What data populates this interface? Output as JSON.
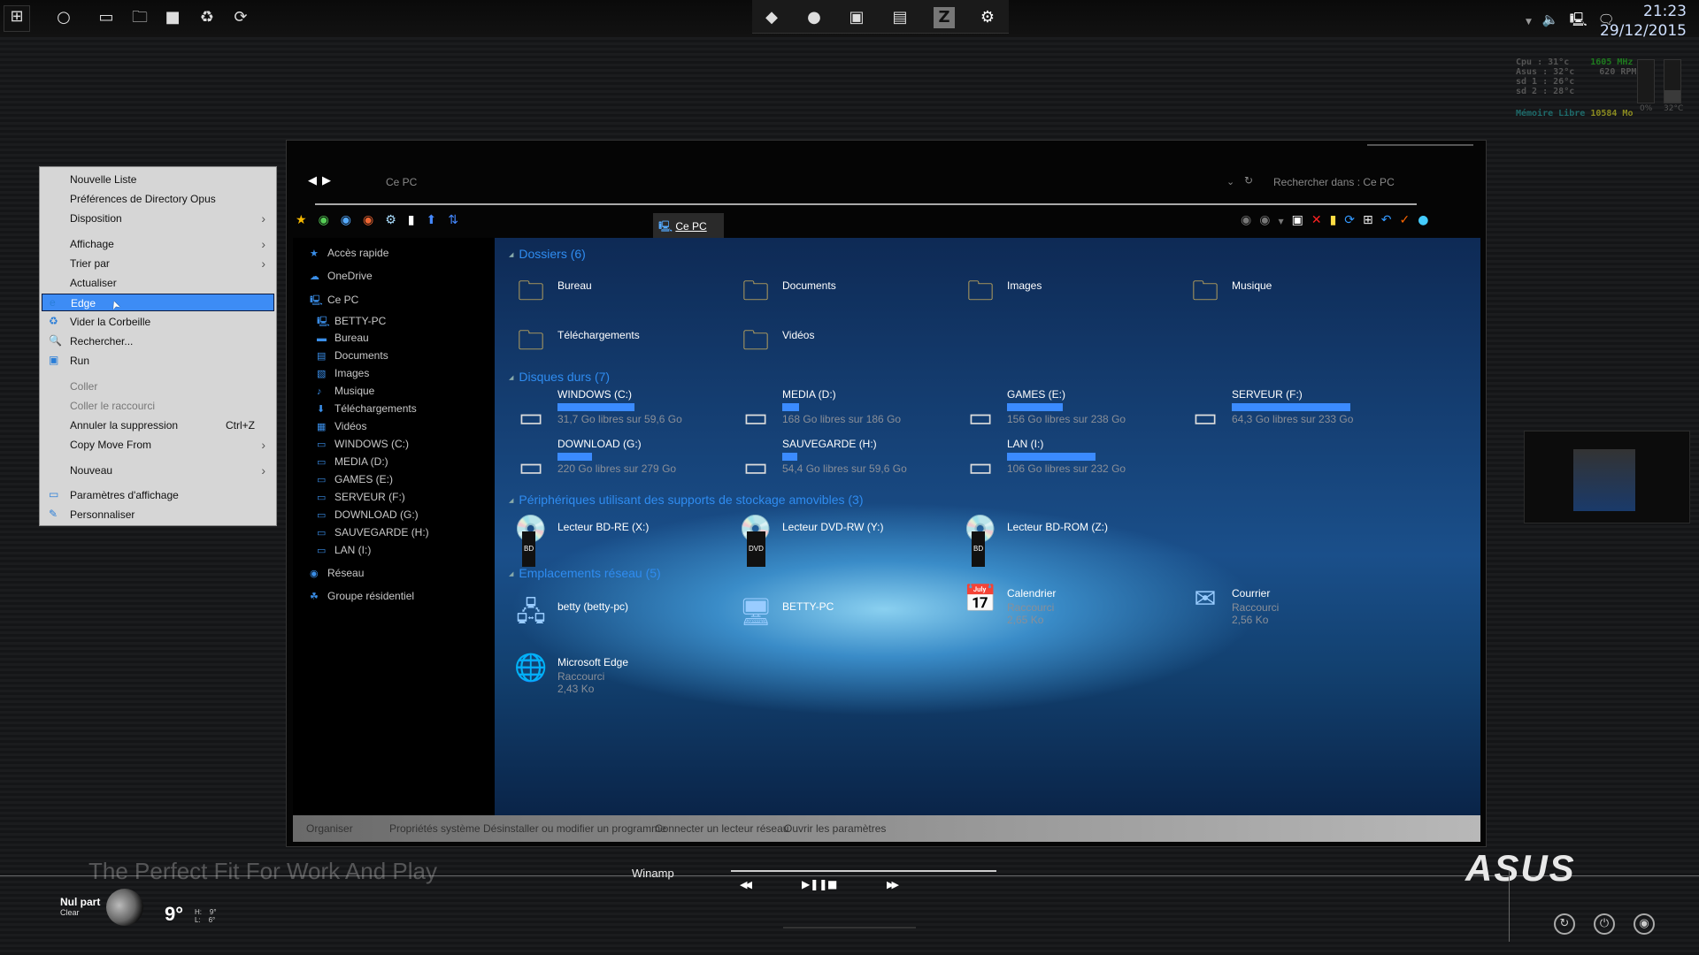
{
  "taskbar": {
    "left_icons": [
      "windows-start-icon",
      "cortana-circle-icon",
      "task-view-icon",
      "file-explorer-icon",
      "camera-icon",
      "recycle-icon",
      "steam-icon"
    ],
    "center_icons": [
      "dock-drive-icon",
      "dock-webcam-icon",
      "dock-media-icon",
      "dock-archive-icon",
      "dock-z-icon",
      "dock-settings-icon"
    ],
    "tray_icons": [
      "chevron-up-icon",
      "volume-icon",
      "network-icon",
      "notifications-icon"
    ],
    "time": "21:23",
    "date": "29/12/2015"
  },
  "sysmon": {
    "cpu_label": "Cpu :",
    "cpu": "31°c",
    "asus_label": "Asus :",
    "asus": "32°c",
    "sd1_label": "sd 1 :",
    "sd1": "26°c",
    "sd2_label": "sd 2 :",
    "sd2": "28°c",
    "freq": "1605 MHz",
    "rpm": "620 RPM",
    "mem_label": "Mémoire Libre",
    "mem": "10584 Mo",
    "meter1": "0%",
    "meter2": "32°C",
    "meter2_level": 0.3,
    "colors": {
      "freq": "#1f7a1f",
      "mem_label": "#1e6a6a",
      "mem": "#8a8a20"
    }
  },
  "context_menu": {
    "items": [
      {
        "label": "Nouvelle Liste"
      },
      {
        "label": "Préférences de Directory Opus"
      },
      {
        "label": "Disposition",
        "submenu": true
      },
      {
        "label": "Affichage",
        "submenu": true
      },
      {
        "label": "Trier par",
        "submenu": true
      },
      {
        "label": "Actualiser"
      },
      {
        "label": "Edge",
        "icon": "edge-icon",
        "selected": true
      },
      {
        "label": "Vider la Corbeille",
        "icon": "recycle-bin-icon"
      },
      {
        "label": "Rechercher...",
        "icon": "search-icon"
      },
      {
        "label": "Run",
        "icon": "run-icon"
      },
      {
        "label": "Coller",
        "disabled": true
      },
      {
        "label": "Coller le raccourci",
        "disabled": true
      },
      {
        "label": "Annuler la suppression",
        "shortcut": "Ctrl+Z"
      },
      {
        "label": "Copy Move From",
        "submenu": true
      },
      {
        "label": "Nouveau",
        "submenu": true
      },
      {
        "label": "Paramètres d'affichage",
        "icon": "display-icon"
      },
      {
        "label": "Personnaliser",
        "icon": "personalize-icon"
      }
    ]
  },
  "explorer": {
    "address": "Ce PC",
    "search_placeholder": "Rechercher dans : Ce PC",
    "tab": "Ce PC",
    "tab_close": "x",
    "sidebar": [
      {
        "label": "Accès rapide",
        "icon": "star-icon",
        "level": 0
      },
      {
        "label": "OneDrive",
        "icon": "cloud-icon",
        "level": 0
      },
      {
        "label": "Ce PC",
        "icon": "computer-icon",
        "level": 0
      },
      {
        "label": "BETTY-PC",
        "icon": "computer-icon",
        "level": 1
      },
      {
        "label": "Bureau",
        "icon": "desktop-icon",
        "level": 1
      },
      {
        "label": "Documents",
        "icon": "document-icon",
        "level": 1
      },
      {
        "label": "Images",
        "icon": "image-icon",
        "level": 1
      },
      {
        "label": "Musique",
        "icon": "music-icon",
        "level": 1
      },
      {
        "label": "Téléchargements",
        "icon": "download-icon",
        "level": 1
      },
      {
        "label": "Vidéos",
        "icon": "video-icon",
        "level": 1
      },
      {
        "label": "WINDOWS (C:)",
        "icon": "drive-icon",
        "level": 1
      },
      {
        "label": "MEDIA (D:)",
        "icon": "drive-icon",
        "level": 1
      },
      {
        "label": "GAMES (E:)",
        "icon": "drive-icon",
        "level": 1
      },
      {
        "label": "SERVEUR (F:)",
        "icon": "drive-icon",
        "level": 1
      },
      {
        "label": "DOWNLOAD (G:)",
        "icon": "drive-icon",
        "level": 1
      },
      {
        "label": "SAUVEGARDE (H:)",
        "icon": "drive-icon",
        "level": 1
      },
      {
        "label": "LAN (I:)",
        "icon": "drive-icon",
        "level": 1
      },
      {
        "label": "Réseau",
        "icon": "network-icon",
        "level": 0
      },
      {
        "label": "Groupe résidentiel",
        "icon": "homegroup-icon",
        "level": 0
      }
    ],
    "groups": {
      "folders": "Dossiers (6)",
      "drives": "Disques durs (7)",
      "removable": "Périphériques utilisant des supports de stockage amovibles (3)",
      "network": "Emplacements réseau (5)"
    },
    "folders": [
      {
        "label": "Bureau",
        "icon": "folder-desktop-icon"
      },
      {
        "label": "Documents",
        "icon": "folder-documents-icon"
      },
      {
        "label": "Images",
        "icon": "folder-images-icon"
      },
      {
        "label": "Musique",
        "icon": "folder-music-icon"
      },
      {
        "label": "Téléchargements",
        "icon": "folder-downloads-icon"
      },
      {
        "label": "Vidéos",
        "icon": "folder-videos-icon"
      }
    ],
    "drives": [
      {
        "label": "WINDOWS (C:)",
        "free": "31,7 Go libres sur 59,6 Go",
        "used": 0.47
      },
      {
        "label": "MEDIA (D:)",
        "free": "168 Go libres sur 186 Go",
        "used": 0.1
      },
      {
        "label": "GAMES (E:)",
        "free": "156 Go libres sur 238 Go",
        "used": 0.34
      },
      {
        "label": "SERVEUR (F:)",
        "free": "64,3 Go libres sur 233 Go",
        "used": 0.72
      },
      {
        "label": "DOWNLOAD (G:)",
        "free": "220 Go libres sur 279 Go",
        "used": 0.21
      },
      {
        "label": "SAUVEGARDE (H:)",
        "free": "54,4 Go libres sur 59,6 Go",
        "used": 0.09
      },
      {
        "label": "LAN (I:)",
        "free": "106 Go libres sur 232 Go",
        "used": 0.54
      }
    ],
    "removable": [
      {
        "label": "Lecteur BD-RE (X:)",
        "badge": "BD"
      },
      {
        "label": "Lecteur DVD-RW (Y:)",
        "badge": "DVD"
      },
      {
        "label": "Lecteur BD-ROM (Z:)",
        "badge": "BD"
      }
    ],
    "network": [
      {
        "label": "betty (betty-pc)",
        "icon": "network-share-icon"
      },
      {
        "label": "BETTY-PC",
        "icon": "computer-icon"
      },
      {
        "label": "Calendrier",
        "sub1": "Raccourci",
        "sub2": "2,65 Ko",
        "icon": "calendar-icon"
      },
      {
        "label": "Courrier",
        "sub1": "Raccourci",
        "sub2": "2,56 Ko",
        "icon": "mail-icon"
      },
      {
        "label": "Microsoft Edge",
        "sub1": "Raccourci",
        "sub2": "2,43 Ko",
        "icon": "globe-icon"
      }
    ],
    "bottom_bar": [
      "Organiser",
      "Propriétés système",
      "Désinstaller ou modifier un programme",
      "Connecter un lecteur réseau",
      "Ouvrir les paramètres"
    ]
  },
  "desktop": {
    "tagline": "The Perfect Fit For Work And Play",
    "brand": "ASUS",
    "weather": {
      "location": "Nul part",
      "condition": "Clear",
      "temp": "9°",
      "high_label": "H:",
      "high": "9°",
      "low_label": "L:",
      "low": "6°"
    },
    "winamp": {
      "title": "Winamp",
      "prev": "◀◀",
      "playpause": "▶❚❚",
      "stop": "■",
      "next": "▶▶"
    }
  }
}
